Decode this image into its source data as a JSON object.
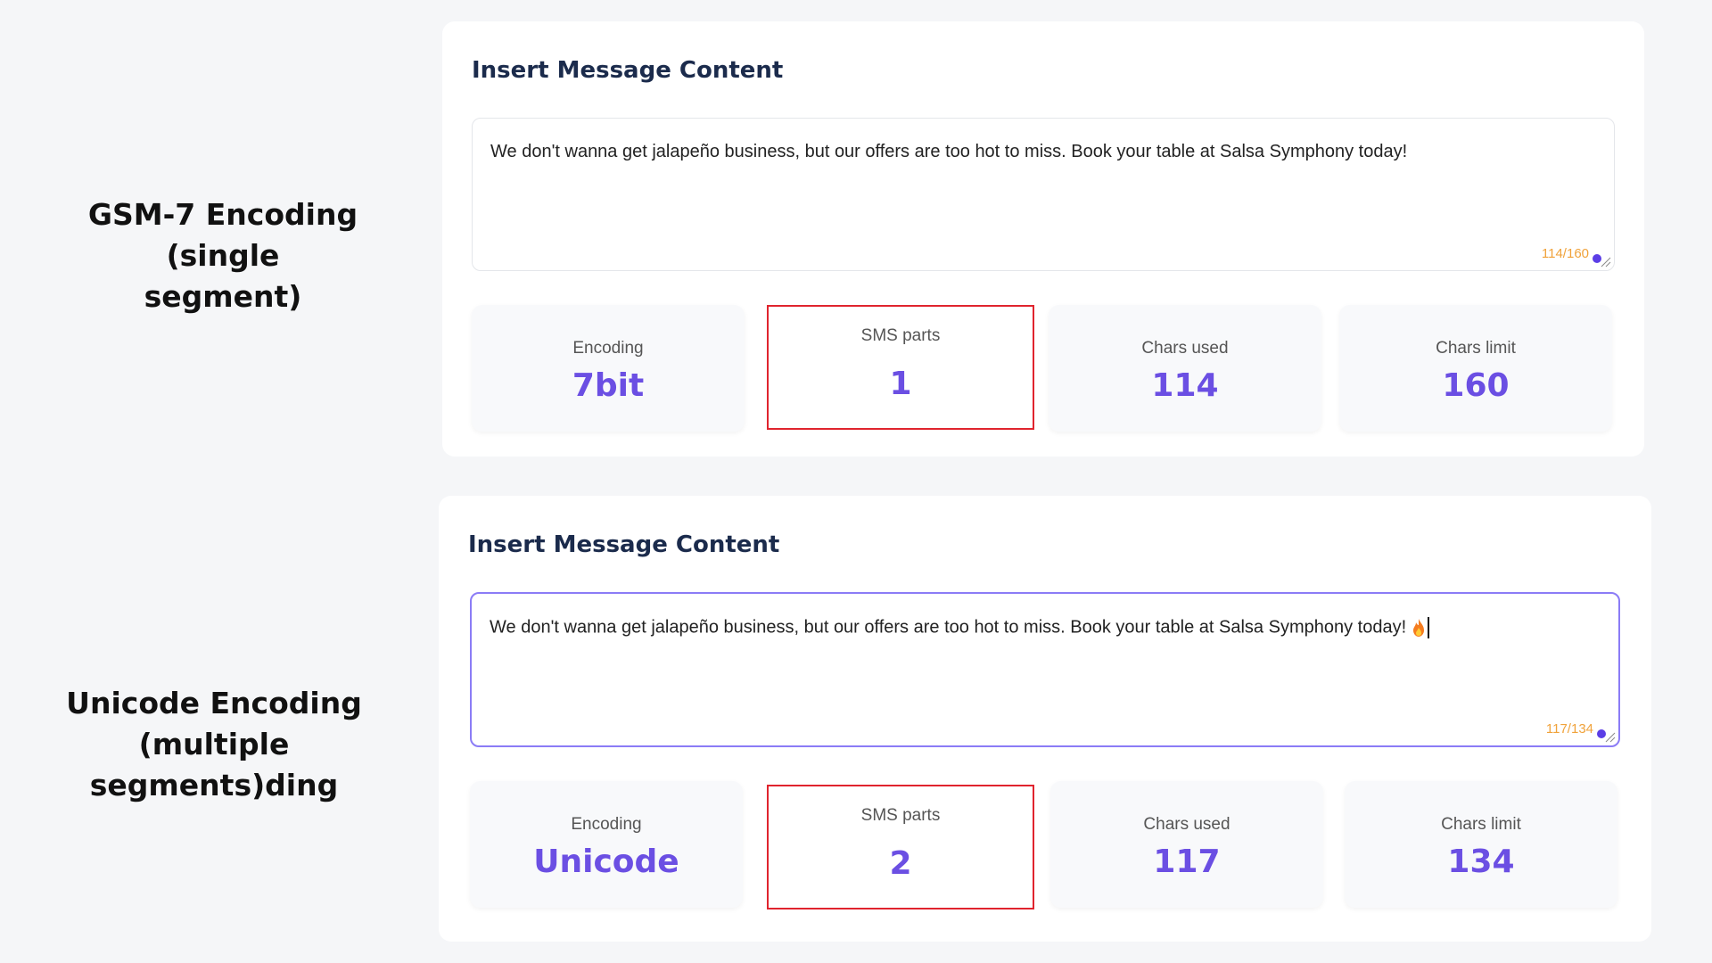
{
  "labels": {
    "gsm": [
      "GSM-7 Encoding (single",
      "segment)"
    ],
    "unicode": [
      "Unicode Encoding",
      "(multiple segments)ding"
    ]
  },
  "panels": [
    {
      "title": "Insert Message Content",
      "message": "We don't wanna get jalapeño business, but our offers are too hot to miss. Book your table at Salsa Symphony today!",
      "counter": "114/160",
      "focused": false,
      "stats": [
        {
          "label": "Encoding",
          "value": "7bit"
        },
        {
          "label": "SMS parts",
          "value": "1"
        },
        {
          "label": "Chars used",
          "value": "114"
        },
        {
          "label": "Chars limit",
          "value": "160"
        }
      ]
    },
    {
      "title": "Insert Message Content",
      "message": "We don't wanna get jalapeño business, but our offers are too hot to miss. Book your table at Salsa Symphony today!",
      "message_emoji": "fire-emoji",
      "counter": "117/134",
      "focused": true,
      "stats": [
        {
          "label": "Encoding",
          "value": "Unicode"
        },
        {
          "label": "SMS parts",
          "value": "2"
        },
        {
          "label": "Chars used",
          "value": "117"
        },
        {
          "label": "Chars limit",
          "value": "134"
        }
      ]
    }
  ],
  "colors": {
    "accent": "#6b4fe3",
    "highlight_border": "#e0242e",
    "counter": "#f0a23a",
    "focus_border": "#8b7cf6"
  }
}
